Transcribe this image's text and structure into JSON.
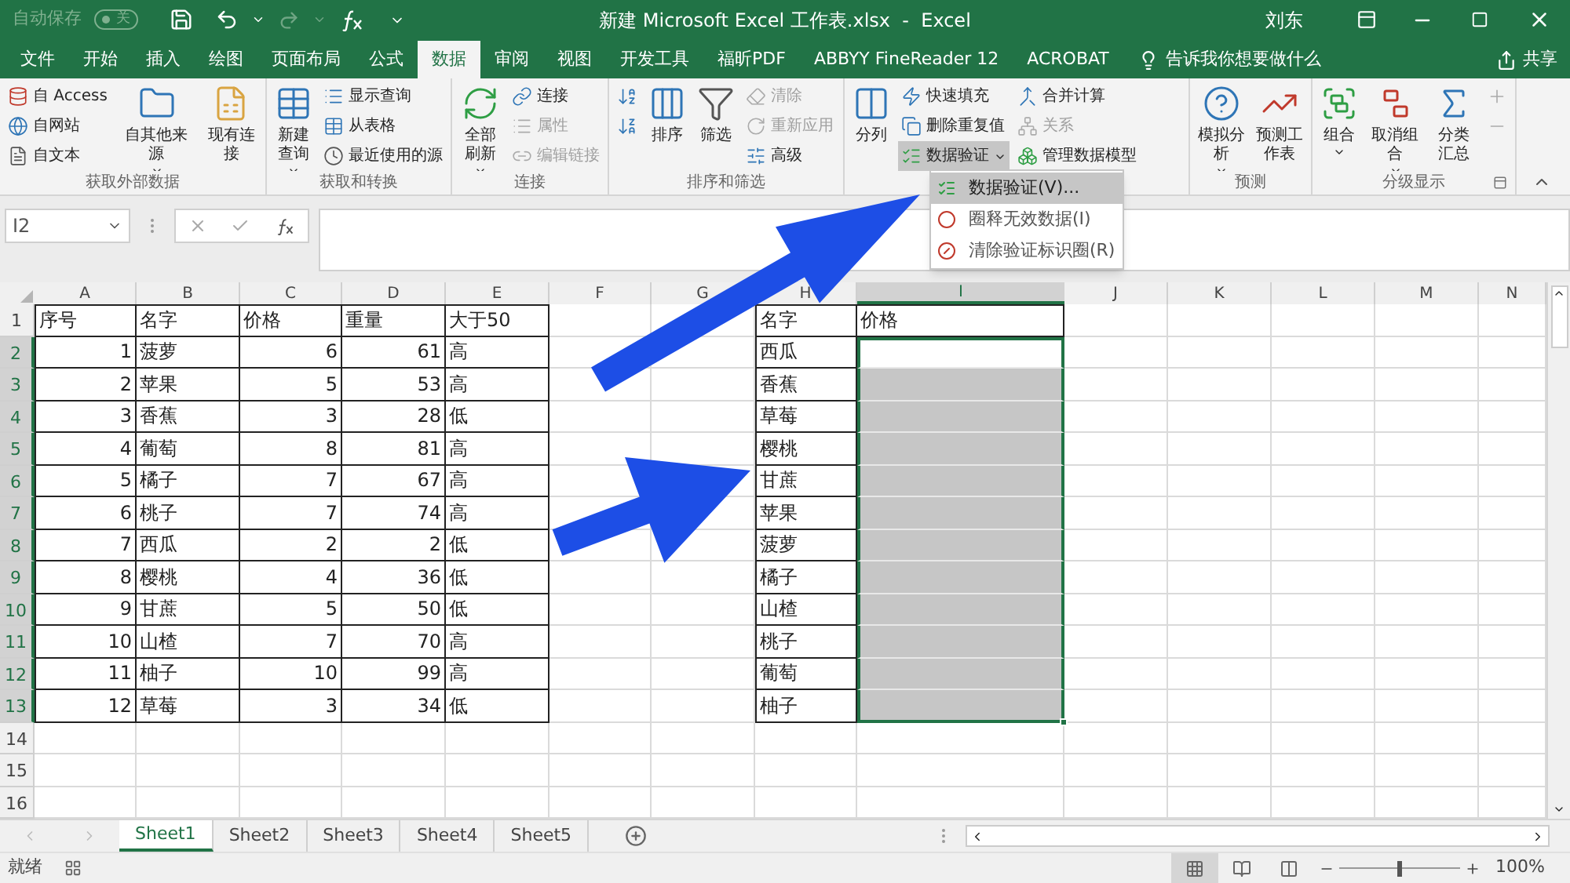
{
  "title_bar": {
    "autosave": {
      "label": "自动保存",
      "state_text": "关",
      "on": false
    },
    "title": "新建 Microsoft Excel 工作表.xlsx  -  Excel",
    "user": "刘东"
  },
  "tabs": [
    {
      "label": "文件",
      "selected": false
    },
    {
      "label": "开始",
      "selected": false
    },
    {
      "label": "插入",
      "selected": false
    },
    {
      "label": "绘图",
      "selected": false
    },
    {
      "label": "页面布局",
      "selected": false
    },
    {
      "label": "公式",
      "selected": false
    },
    {
      "label": "数据",
      "selected": true
    },
    {
      "label": "审阅",
      "selected": false
    },
    {
      "label": "视图",
      "selected": false
    },
    {
      "label": "开发工具",
      "selected": false
    },
    {
      "label": "福昕PDF",
      "selected": false
    },
    {
      "label": "ABBYY FineReader 12",
      "selected": false
    },
    {
      "label": "ACROBAT",
      "selected": false
    }
  ],
  "tell_me": "告诉我你想要做什么",
  "share": "共享",
  "ribbon": {
    "groups": [
      {
        "label": "获取外部数据",
        "items": [
          {
            "kind": "small",
            "label": "自 Access",
            "disabled": false,
            "open": false
          },
          {
            "kind": "small",
            "label": "自网站",
            "disabled": false,
            "open": false
          },
          {
            "kind": "small",
            "label": "自文本",
            "disabled": false,
            "open": false
          },
          {
            "kind": "large",
            "label": "自其他来源",
            "dropdown": true,
            "disabled": false,
            "open": false
          },
          {
            "kind": "large",
            "label": "现有连接",
            "dropdown": false,
            "disabled": false,
            "open": false
          }
        ]
      },
      {
        "label": "获取和转换",
        "items": [
          {
            "kind": "large",
            "label": "新建查询",
            "dropdown": true,
            "disabled": false,
            "open": false
          },
          {
            "kind": "small",
            "label": "显示查询",
            "disabled": false,
            "open": false
          },
          {
            "kind": "small",
            "label": "从表格",
            "disabled": false,
            "open": false
          },
          {
            "kind": "small",
            "label": "最近使用的源",
            "disabled": false,
            "open": false
          }
        ]
      },
      {
        "label": "连接",
        "items": [
          {
            "kind": "large",
            "label": "全部刷新",
            "dropdown": true,
            "disabled": false,
            "open": false
          },
          {
            "kind": "small",
            "label": "连接",
            "disabled": false,
            "open": false
          },
          {
            "kind": "small",
            "label": "属性",
            "disabled": true,
            "open": false
          },
          {
            "kind": "small",
            "label": "编辑链接",
            "disabled": true,
            "open": false
          }
        ]
      },
      {
        "label": "排序和筛选",
        "items": [
          {
            "kind": "icon",
            "disabled": false,
            "open": false
          },
          {
            "kind": "icon",
            "disabled": false,
            "open": false
          },
          {
            "kind": "large",
            "label": "排序",
            "dropdown": false,
            "disabled": false,
            "open": false
          },
          {
            "kind": "large",
            "label": "筛选",
            "dropdown": false,
            "disabled": false,
            "open": false
          },
          {
            "kind": "small",
            "label": "清除",
            "disabled": true,
            "open": false
          },
          {
            "kind": "small",
            "label": "重新应用",
            "disabled": true,
            "open": false
          },
          {
            "kind": "small",
            "label": "高级",
            "disabled": false,
            "open": false
          }
        ]
      },
      {
        "items": [
          {
            "kind": "large",
            "label": "分列",
            "dropdown": false,
            "disabled": false,
            "open": false
          },
          {
            "kind": "small",
            "label": "快速填充",
            "disabled": false,
            "open": false
          },
          {
            "kind": "small",
            "label": "删除重复值",
            "disabled": false,
            "open": false
          },
          {
            "kind": "small",
            "label": "数据验证",
            "dropdown": true,
            "disabled": false,
            "open": true
          },
          {
            "kind": "small",
            "label": "合并计算",
            "disabled": false,
            "open": false
          },
          {
            "kind": "small",
            "label": "关系",
            "disabled": true,
            "open": false
          },
          {
            "kind": "small",
            "label": "管理数据模型",
            "disabled": false,
            "open": false
          }
        ]
      },
      {
        "label": "预测",
        "items": [
          {
            "kind": "large",
            "label": "模拟分析",
            "dropdown": true,
            "disabled": false,
            "open": false
          },
          {
            "kind": "large",
            "label": "预测工作表",
            "dropdown": false,
            "disabled": false,
            "open": false
          }
        ]
      },
      {
        "label": "分级显示",
        "items": [
          {
            "kind": "large",
            "label": "组合",
            "dropdown": true,
            "disabled": false,
            "open": false
          },
          {
            "kind": "large",
            "label": "取消组合",
            "dropdown": true,
            "disabled": false,
            "open": false
          },
          {
            "kind": "large",
            "label": "分类汇总",
            "dropdown": false,
            "disabled": false,
            "open": false
          },
          {
            "kind": "icon",
            "disabled": true,
            "open": false
          },
          {
            "kind": "icon",
            "disabled": true,
            "open": false
          }
        ]
      }
    ]
  },
  "menu": [
    {
      "label": "数据验证(V)...",
      "selected": true
    },
    {
      "label": "圈释无效数据(I)",
      "selected": false
    },
    {
      "label": "清除验证标识圈(R)",
      "selected": false
    }
  ],
  "name_box": "I2",
  "columns": [
    {
      "label": "A",
      "selected": false
    },
    {
      "label": "B",
      "selected": false
    },
    {
      "label": "C",
      "selected": false
    },
    {
      "label": "D",
      "selected": false
    },
    {
      "label": "E",
      "selected": false
    },
    {
      "label": "F",
      "selected": false
    },
    {
      "label": "G",
      "selected": false
    },
    {
      "label": "H",
      "selected": false
    },
    {
      "label": "I",
      "selected": true
    },
    {
      "label": "J",
      "selected": false
    },
    {
      "label": "K",
      "selected": false
    },
    {
      "label": "L",
      "selected": false
    },
    {
      "label": "M",
      "selected": false
    },
    {
      "label": "N",
      "selected": false
    }
  ],
  "rows": [
    {
      "label": "1",
      "selected": false
    },
    {
      "label": "2",
      "selected": true
    },
    {
      "label": "3",
      "selected": true
    },
    {
      "label": "4",
      "selected": true
    },
    {
      "label": "5",
      "selected": true
    },
    {
      "label": "6",
      "selected": true
    },
    {
      "label": "7",
      "selected": true
    },
    {
      "label": "8",
      "selected": true
    },
    {
      "label": "9",
      "selected": true
    },
    {
      "label": "10",
      "selected": true
    },
    {
      "label": "11",
      "selected": true
    },
    {
      "label": "12",
      "selected": true
    },
    {
      "label": "13",
      "selected": true
    },
    {
      "label": "14",
      "selected": false
    },
    {
      "label": "15",
      "selected": false
    },
    {
      "label": "16",
      "selected": false
    }
  ],
  "left_table": {
    "columns": [
      {
        "label": "序号",
        "numeric": true
      },
      {
        "label": "名字",
        "numeric": false
      },
      {
        "label": "价格",
        "numeric": true
      },
      {
        "label": "重量",
        "numeric": true
      },
      {
        "label": "大于50",
        "numeric": false
      }
    ],
    "rows": [
      [
        "1",
        "菠萝",
        "6",
        "61",
        "高"
      ],
      [
        "2",
        "苹果",
        "5",
        "53",
        "高"
      ],
      [
        "3",
        "香蕉",
        "3",
        "28",
        "低"
      ],
      [
        "4",
        "葡萄",
        "8",
        "81",
        "高"
      ],
      [
        "5",
        "橘子",
        "7",
        "67",
        "高"
      ],
      [
        "6",
        "桃子",
        "7",
        "74",
        "高"
      ],
      [
        "7",
        "西瓜",
        "2",
        "2",
        "低"
      ],
      [
        "8",
        "樱桃",
        "4",
        "36",
        "低"
      ],
      [
        "9",
        "甘蔗",
        "5",
        "50",
        "低"
      ],
      [
        "10",
        "山楂",
        "7",
        "70",
        "高"
      ],
      [
        "11",
        "柚子",
        "10",
        "99",
        "高"
      ],
      [
        "12",
        "草莓",
        "3",
        "34",
        "低"
      ]
    ]
  },
  "right_table": {
    "columns": [
      {
        "label": "名字"
      },
      {
        "label": "价格"
      }
    ],
    "rows": [
      {
        "name": "西瓜",
        "selected": true,
        "active": true
      },
      {
        "name": "香蕉",
        "selected": true,
        "active": false
      },
      {
        "name": "草莓",
        "selected": true,
        "active": false
      },
      {
        "name": "樱桃",
        "selected": true,
        "active": false
      },
      {
        "name": "甘蔗",
        "selected": true,
        "active": false
      },
      {
        "name": "苹果",
        "selected": true,
        "active": false
      },
      {
        "name": "菠萝",
        "selected": true,
        "active": false
      },
      {
        "name": "橘子",
        "selected": true,
        "active": false
      },
      {
        "name": "山楂",
        "selected": true,
        "active": false
      },
      {
        "name": "桃子",
        "selected": true,
        "active": false
      },
      {
        "name": "葡萄",
        "selected": true,
        "active": false
      },
      {
        "name": "柚子",
        "selected": true,
        "active": false
      }
    ]
  },
  "sheets": [
    {
      "label": "Sheet1",
      "selected": true
    },
    {
      "label": "Sheet2",
      "selected": false
    },
    {
      "label": "Sheet3",
      "selected": false
    },
    {
      "label": "Sheet4",
      "selected": false
    },
    {
      "label": "Sheet5",
      "selected": false
    }
  ],
  "status_bar": {
    "text": "就绪",
    "views": [
      {
        "selected": true
      },
      {
        "selected": false
      },
      {
        "selected": false
      }
    ],
    "zoom": {
      "level": 0.5,
      "text": "100%"
    }
  }
}
